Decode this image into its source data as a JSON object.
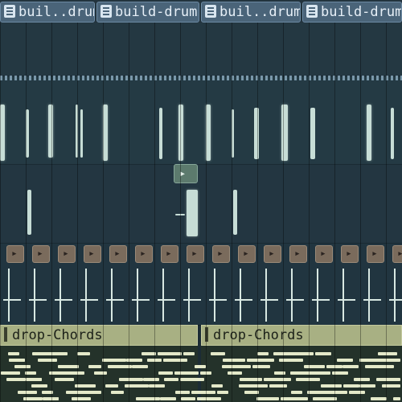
{
  "clips": {
    "top_row": [
      {
        "label": "buil..drums"
      },
      {
        "label": "build-drums"
      },
      {
        "label": "buil..drums"
      },
      {
        "label": "build-drums"
      }
    ],
    "chords": [
      {
        "label": "drop-Chords"
      },
      {
        "label": "drop-Chords"
      }
    ]
  },
  "colors": {
    "drum_clip": "#4a6479",
    "chord_clip": "#a8b083",
    "waveform": "#c7ddd6",
    "background": "#22333d"
  },
  "icons": [
    "pattern-icon",
    "audio-clip-icon"
  ]
}
